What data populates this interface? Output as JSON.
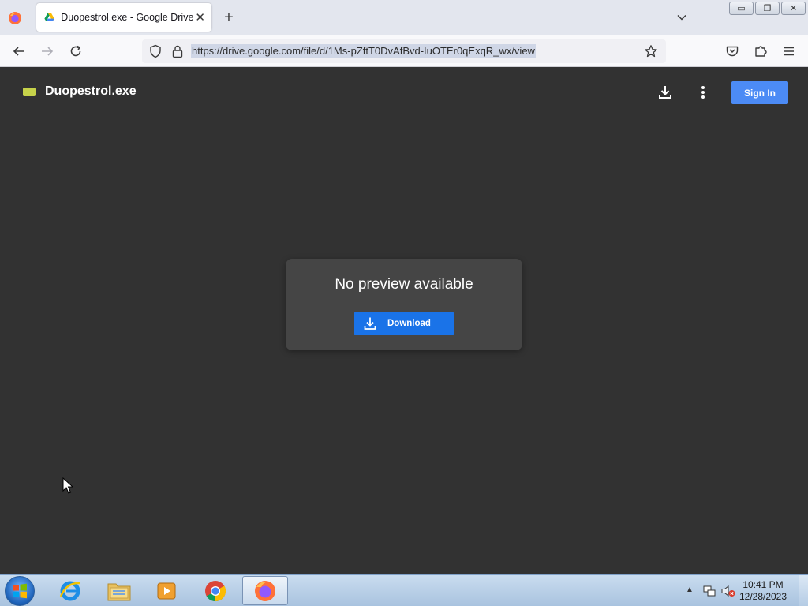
{
  "browser": {
    "tab": {
      "title": "Duopestrol.exe - Google Drive",
      "close_glyph": "✕"
    },
    "new_tab_glyph": "+",
    "url": "https://drive.google.com/file/d/1Ms-pZftT0DvAfBvd-IuOTEr0qExqR_wx/view",
    "window_buttons": {
      "minimize": "▭",
      "restore": "❐",
      "close": "✕"
    }
  },
  "viewer": {
    "file_name": "Duopestrol.exe",
    "sign_in_label": "Sign In",
    "no_preview_text": "No preview available",
    "download_label": "Download"
  },
  "taskbar": {
    "apps": [
      "internet-explorer-icon",
      "file-explorer-icon",
      "media-player-icon",
      "chrome-icon",
      "firefox-icon"
    ],
    "tray_arrow": "▲",
    "time": "10:41 PM",
    "date": "12/28/2023"
  },
  "colors": {
    "viewer_bg": "#323232",
    "card_bg": "#454545",
    "download_button": "#1a73e8",
    "sign_in_button": "#4c8bf5",
    "file_icon": "#c6d24a"
  }
}
